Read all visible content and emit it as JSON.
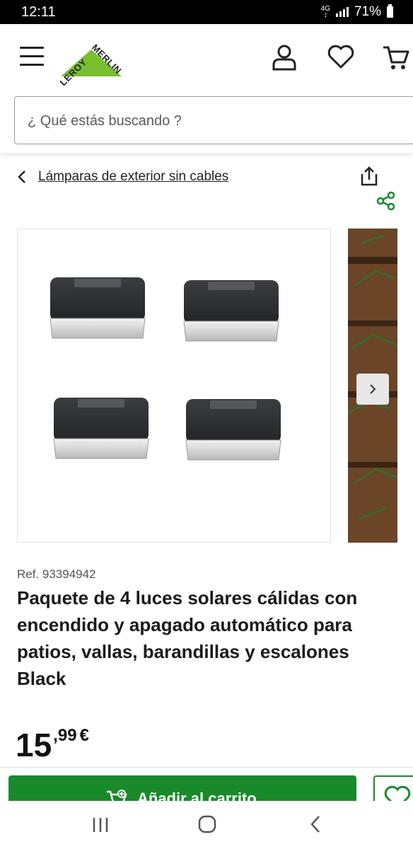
{
  "status_bar": {
    "time": "12:11",
    "network": "4G",
    "battery": "71%"
  },
  "header": {
    "logo_text_top": "MERLIN",
    "logo_text_left": "LEROY",
    "brand_color": "#78C02D",
    "search_placeholder": "¿ Qué estás buscando ?"
  },
  "breadcrumb": {
    "label": "Lámparas de exterior sin cables"
  },
  "product": {
    "ref": "Ref. 93394942",
    "title": "Paquete de 4 luces solares cálidas con encendido y apagado automático para patios, vallas, barandillas y escalones Black",
    "price_int": "15",
    "price_dec": ",99",
    "currency": "€"
  },
  "actions": {
    "add_to_cart": "Añadir al carrito",
    "accent": "#188A2A"
  },
  "icons": [
    "menu-icon",
    "user-icon",
    "heart-icon",
    "cart-icon",
    "share-icon",
    "network-share-icon",
    "chevron-left-icon",
    "chevron-right-icon"
  ]
}
